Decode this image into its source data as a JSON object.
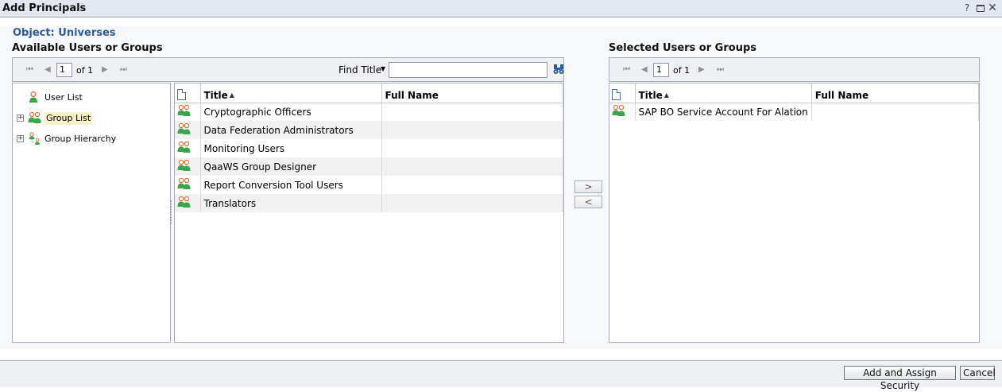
{
  "window": {
    "title": "Add Principals",
    "help_glyph": "?",
    "close_glyph": "✕"
  },
  "object_label": "Object: Universes",
  "available": {
    "heading": "Available Users or Groups",
    "pager": {
      "page": "1",
      "of_label": "of 1"
    },
    "find": {
      "label": "Find Title",
      "value": "",
      "placeholder": ""
    },
    "tree": [
      {
        "label": "User List",
        "icon": "user-icon",
        "expandable": false
      },
      {
        "label": "Group List",
        "icon": "group-icon",
        "expandable": true,
        "selected": true
      },
      {
        "label": "Group Hierarchy",
        "icon": "group-hierarchy-icon",
        "expandable": true
      }
    ],
    "columns": {
      "title": "Title",
      "full_name": "Full Name"
    },
    "rows": [
      {
        "title": "Cryptographic Officers",
        "full_name": ""
      },
      {
        "title": "Data Federation Administrators",
        "full_name": ""
      },
      {
        "title": "Monitoring Users",
        "full_name": ""
      },
      {
        "title": "QaaWS Group Designer",
        "full_name": ""
      },
      {
        "title": "Report Conversion Tool Users",
        "full_name": ""
      },
      {
        "title": "Translators",
        "full_name": ""
      }
    ]
  },
  "move_buttons": {
    "add": ">",
    "remove": "<"
  },
  "selected": {
    "heading": "Selected Users or Groups",
    "pager": {
      "page": "1",
      "of_label": "of 1"
    },
    "columns": {
      "title": "Title",
      "full_name": "Full Name"
    },
    "rows": [
      {
        "title": "SAP BO Service Account For Alation",
        "full_name": ""
      }
    ]
  },
  "footer": {
    "add_assign_label": "Add and Assign Security",
    "cancel_label": "Cancel"
  },
  "colors": {
    "object_label": "#2e5a9c",
    "group_icon_green": "#3aa54a",
    "group_icon_orange": "#e06a2c"
  }
}
